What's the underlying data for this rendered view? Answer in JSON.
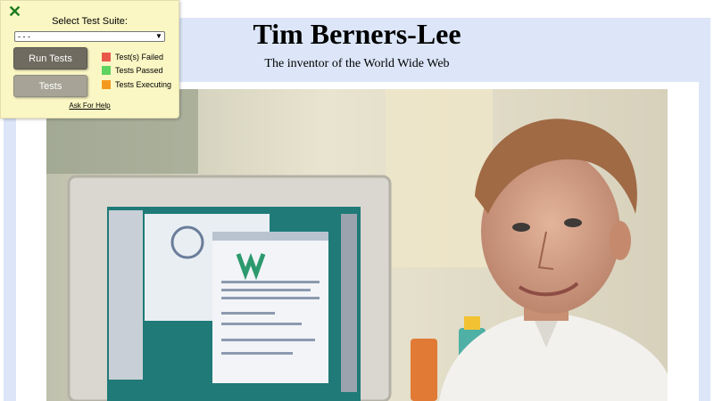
{
  "page": {
    "title": "Tim Berners-Lee",
    "subtitle": "The inventor of the World Wide Web"
  },
  "test_panel": {
    "close_icon": "✕",
    "heading": "Select Test Suite:",
    "select_value": "- - -",
    "run_button": "Run Tests",
    "tests_button": "Tests",
    "legend": [
      {
        "label": "Test(s) Failed",
        "color": "#e8594a"
      },
      {
        "label": "Tests Passed",
        "color": "#5fd35f"
      },
      {
        "label": "Tests Executing",
        "color": "#f39a1e"
      }
    ],
    "help_link": "Ask For Help"
  },
  "colors": {
    "page_background": "#dce6f8",
    "panel_background": "#fbf7c4"
  }
}
